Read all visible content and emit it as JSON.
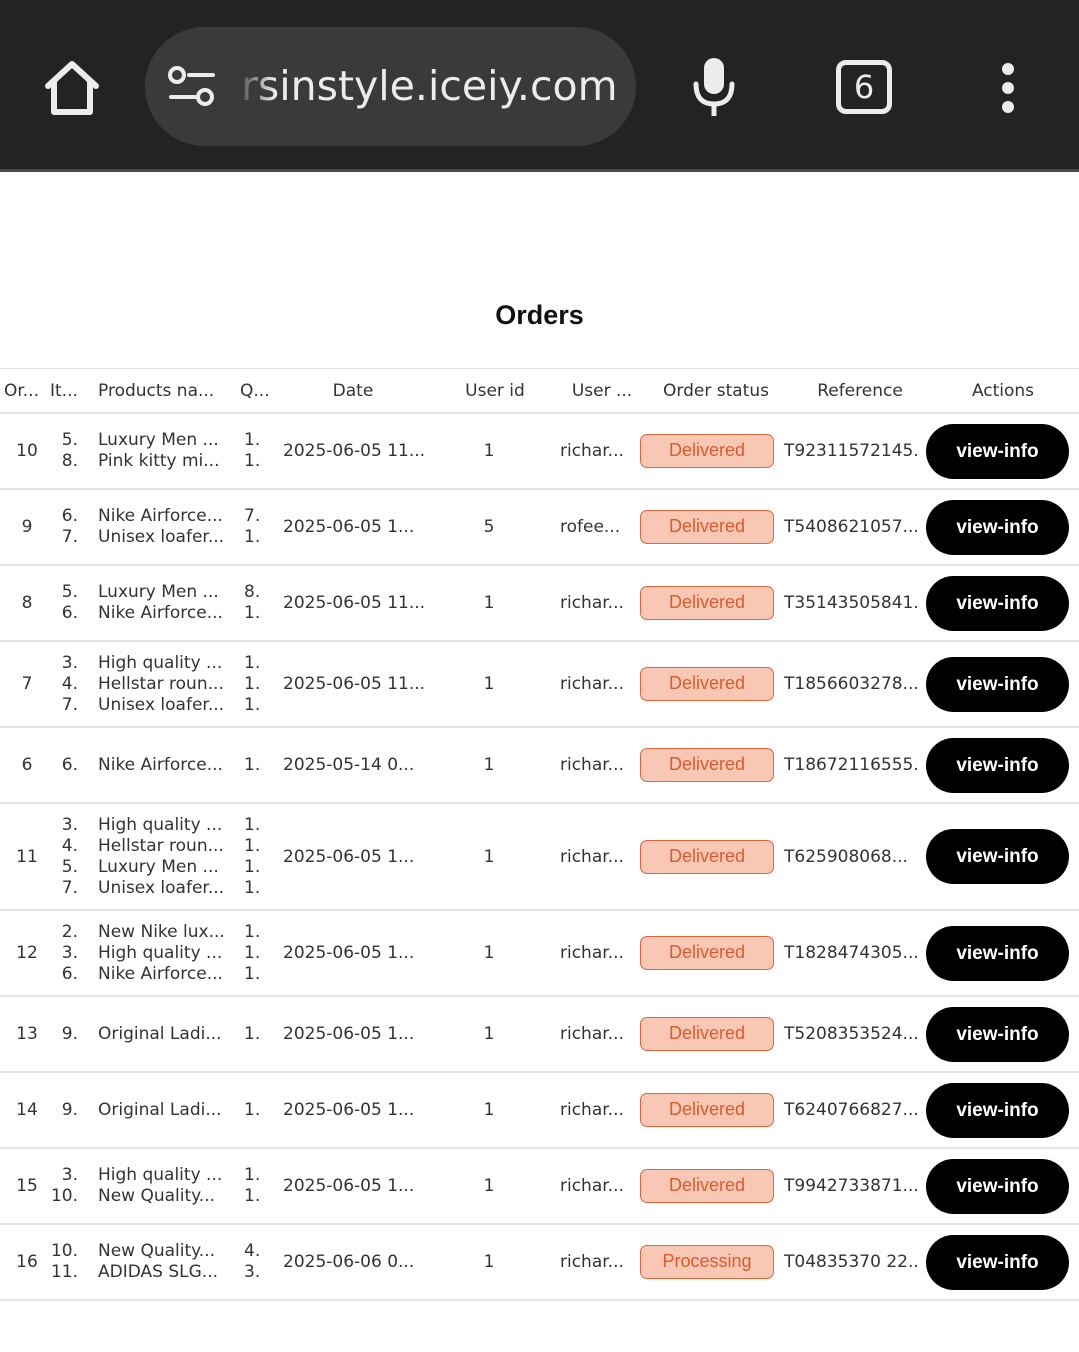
{
  "browser": {
    "url": "rsinstyle.iceiy.com",
    "tab_count": "6"
  },
  "page": {
    "title": "Orders"
  },
  "colors": {
    "status_bg": "#f8c8b4",
    "status_border": "#e0653a",
    "status_text": "#dc5a2c",
    "button_bg": "#000000"
  },
  "table": {
    "headers": {
      "order": "Or...",
      "item": "It...",
      "products": "Products na...",
      "qty": "Q...",
      "date": "Date",
      "user_id": "User id",
      "user_name": "User ...",
      "status": "Order status",
      "reference": "Reference",
      "actions": "Actions"
    },
    "rows": [
      {
        "order": "10",
        "items": [
          "5.",
          "8."
        ],
        "products": [
          "Luxury Men ...",
          "Pink kitty mi..."
        ],
        "qty": [
          "1.",
          "1."
        ],
        "date": "2025-06-05 11...",
        "user_id": "1",
        "user_name": "richar...",
        "status": "Delivered",
        "reference": "T92311572145...",
        "action": "view-info"
      },
      {
        "order": "9",
        "items": [
          "6.",
          "7."
        ],
        "products": [
          "Nike Airforce...",
          "Unisex loafer..."
        ],
        "qty": [
          "7.",
          "1."
        ],
        "date": "2025-06-05 1...",
        "user_id": "5",
        "user_name": "rofee...",
        "status": "Delivered",
        "reference": "T5408621057...",
        "action": "view-info"
      },
      {
        "order": "8",
        "items": [
          "5.",
          "6."
        ],
        "products": [
          "Luxury Men ...",
          "Nike Airforce..."
        ],
        "qty": [
          "8.",
          "1."
        ],
        "date": "2025-06-05 11...",
        "user_id": "1",
        "user_name": "richar...",
        "status": "Delivered",
        "reference": "T35143505841...",
        "action": "view-info"
      },
      {
        "order": "7",
        "items": [
          "3.",
          "4.",
          "7."
        ],
        "products": [
          "High quality ...",
          "Hellstar roun...",
          "Unisex loafer..."
        ],
        "qty": [
          "1.",
          "1.",
          "1."
        ],
        "date": "2025-06-05 11...",
        "user_id": "1",
        "user_name": "richar...",
        "status": "Delivered",
        "reference": "T1856603278...",
        "action": "view-info"
      },
      {
        "order": "6",
        "items": [
          "6."
        ],
        "products": [
          "Nike Airforce..."
        ],
        "qty": [
          "1."
        ],
        "date": "2025-05-14 0...",
        "user_id": "1",
        "user_name": "richar...",
        "status": "Delivered",
        "reference": "T18672116555...",
        "action": "view-info"
      },
      {
        "order": "11",
        "items": [
          "3.",
          "4.",
          "5.",
          "7."
        ],
        "products": [
          "High quality ...",
          "Hellstar roun...",
          "Luxury Men ...",
          "Unisex loafer..."
        ],
        "qty": [
          "1.",
          "1.",
          "1.",
          "1."
        ],
        "date": "2025-06-05 1...",
        "user_id": "1",
        "user_name": "richar...",
        "status": "Delivered",
        "reference": "T625908068...",
        "action": "view-info"
      },
      {
        "order": "12",
        "items": [
          "2.",
          "3.",
          "6."
        ],
        "products": [
          "New Nike lux...",
          "High quality ...",
          "Nike Airforce..."
        ],
        "qty": [
          "1.",
          "1.",
          "1."
        ],
        "date": "2025-06-05 1...",
        "user_id": "1",
        "user_name": "richar...",
        "status": "Delivered",
        "reference": "T1828474305...",
        "action": "view-info"
      },
      {
        "order": "13",
        "items": [
          "9."
        ],
        "products": [
          "Original Ladi..."
        ],
        "qty": [
          "1."
        ],
        "date": "2025-06-05 1...",
        "user_id": "1",
        "user_name": "richar...",
        "status": "Delivered",
        "reference": "T5208353524...",
        "action": "view-info"
      },
      {
        "order": "14",
        "items": [
          "9."
        ],
        "products": [
          "Original Ladi..."
        ],
        "qty": [
          "1."
        ],
        "date": "2025-06-05 1...",
        "user_id": "1",
        "user_name": "richar...",
        "status": "Delivered",
        "reference": "T6240766827...",
        "action": "view-info"
      },
      {
        "order": "15",
        "items": [
          "3.",
          "10."
        ],
        "products": [
          "High quality ...",
          "New Quality..."
        ],
        "qty": [
          "1.",
          "1."
        ],
        "date": "2025-06-05 1...",
        "user_id": "1",
        "user_name": "richar...",
        "status": "Delivered",
        "reference": "T9942733871...",
        "action": "view-info"
      },
      {
        "order": "16",
        "items": [
          "10.",
          "11."
        ],
        "products": [
          "New Quality...",
          "ADIDAS SLG..."
        ],
        "qty": [
          "4.",
          "3."
        ],
        "date": "2025-06-06 0...",
        "user_id": "1",
        "user_name": "richar...",
        "status": "Processing",
        "reference": "T04835370 22...",
        "action": "view-info"
      }
    ]
  }
}
